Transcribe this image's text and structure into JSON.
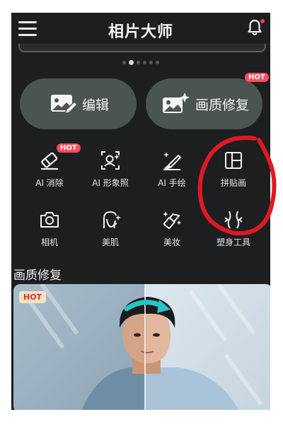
{
  "app": {
    "title": "相片大师"
  },
  "banner": {
    "page_count": 6,
    "active_index": 1
  },
  "main_actions": [
    {
      "label": "编辑",
      "icon": "image-edit-icon",
      "hot": false
    },
    {
      "label": "画质修复",
      "icon": "image-sparkle-icon",
      "hot": true,
      "hot_label": "HOT"
    }
  ],
  "tools": [
    {
      "label": "AI 消除",
      "icon": "eraser-icon",
      "hot": true,
      "hot_label": "HOT"
    },
    {
      "label": "AI 形象照",
      "icon": "portrait-sparkle-icon",
      "hot": false
    },
    {
      "label": "AI 手绘",
      "icon": "brush-sparkle-icon",
      "hot": false
    },
    {
      "label": "拼贴画",
      "icon": "collage-grid-icon",
      "hot": false
    },
    {
      "label": "相机",
      "icon": "camera-icon",
      "hot": false
    },
    {
      "label": "美肌",
      "icon": "face-sparkle-icon",
      "hot": false
    },
    {
      "label": "美妆",
      "icon": "lipstick-icon",
      "hot": false
    },
    {
      "label": "塑身工具",
      "icon": "body-shape-icon",
      "hot": false
    }
  ],
  "section": {
    "title": "画质修复",
    "card_badge": "HOT"
  },
  "colors": {
    "background": "#1d1e20",
    "pill": "#4a5451",
    "hot": "#ff4d5a",
    "annotation": "#e01820"
  }
}
